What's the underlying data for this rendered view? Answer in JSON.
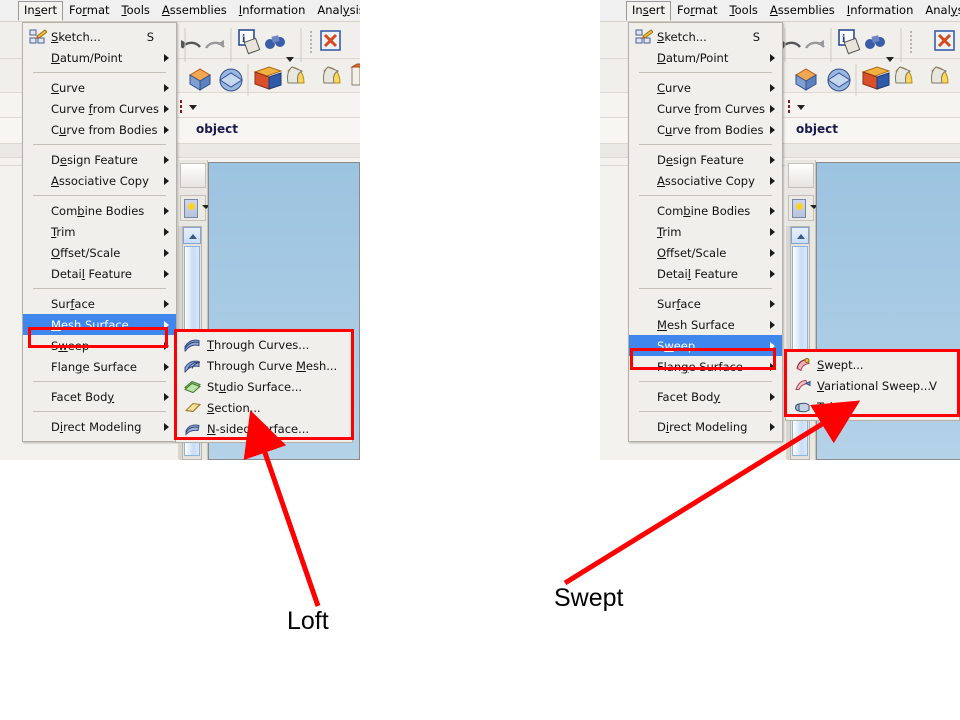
{
  "app": {
    "menubar": [
      {
        "label": "Insert",
        "mnemonic": "s",
        "active": true
      },
      {
        "label": "Format",
        "mnemonic": "r",
        "active": false
      },
      {
        "label": "Tools",
        "mnemonic": "T",
        "active": false
      },
      {
        "label": "Assemblies",
        "mnemonic": "A",
        "active": false
      },
      {
        "label": "Information",
        "mnemonic": "I",
        "active": false
      },
      {
        "label": "Analysis",
        "mnemonic": "y",
        "active": false
      }
    ],
    "cue_text": "object",
    "colors": {
      "menu_background": "#f1efec",
      "menu_highlight": "#3f86ed",
      "annotation_red": "#ff0000",
      "viewport_blue": "#a6cbe4",
      "menubar_background": "#f0f0f0"
    }
  },
  "insert_menu": {
    "title": "Insert",
    "items": [
      {
        "label": "Sketch...",
        "mnemonic": "S",
        "accel": "S",
        "icon": "sketch-icon",
        "submenu": false
      },
      {
        "label": "Datum/Point",
        "mnemonic": "D",
        "accel": "",
        "icon": "",
        "submenu": true
      },
      {
        "separator": true
      },
      {
        "label": "Curve",
        "mnemonic": "C",
        "accel": "",
        "icon": "",
        "submenu": true
      },
      {
        "label": "Curve from Curves",
        "mnemonic": "f",
        "accel": "",
        "icon": "",
        "submenu": true
      },
      {
        "label": "Curve from Bodies",
        "mnemonic": "u",
        "accel": "",
        "icon": "",
        "submenu": true
      },
      {
        "separator": true
      },
      {
        "label": "Design Feature",
        "mnemonic": "e",
        "accel": "",
        "icon": "",
        "submenu": true
      },
      {
        "label": "Associative Copy",
        "mnemonic": "A",
        "accel": "",
        "icon": "",
        "submenu": true
      },
      {
        "separator": true
      },
      {
        "label": "Combine Bodies",
        "mnemonic": "b",
        "accel": "",
        "icon": "",
        "submenu": true
      },
      {
        "label": "Trim",
        "mnemonic": "T",
        "accel": "",
        "icon": "",
        "submenu": true
      },
      {
        "label": "Offset/Scale",
        "mnemonic": "O",
        "accel": "",
        "icon": "",
        "submenu": true
      },
      {
        "label": "Detail Feature",
        "mnemonic": "l",
        "accel": "",
        "icon": "",
        "submenu": true
      },
      {
        "separator": true
      },
      {
        "label": "Surface",
        "mnemonic": "f",
        "accel": "",
        "icon": "",
        "submenu": true
      },
      {
        "label": "Mesh Surface",
        "mnemonic": "M",
        "accel": "",
        "icon": "",
        "submenu": true
      },
      {
        "label": "Sweep",
        "mnemonic": "w",
        "accel": "",
        "icon": "",
        "submenu": true
      },
      {
        "label": "Flange Surface",
        "mnemonic": "g",
        "accel": "",
        "icon": "",
        "submenu": true
      },
      {
        "separator": true
      },
      {
        "label": "Facet Body",
        "mnemonic": "y",
        "accel": "",
        "icon": "",
        "submenu": true
      },
      {
        "separator": true
      },
      {
        "label": "Direct Modeling",
        "mnemonic": "i",
        "accel": "",
        "icon": "",
        "submenu": true
      }
    ]
  },
  "left_panel": {
    "selected_item": "Mesh Surface",
    "annotation_label": "Loft",
    "submenu": {
      "parent": "Mesh Surface",
      "items": [
        {
          "label": "Through Curves...",
          "mnemonic": "T",
          "accel": "",
          "icon": "through-curves-icon"
        },
        {
          "label": "Through Curve Mesh...",
          "mnemonic": "M",
          "accel": "",
          "icon": "through-curve-mesh-icon"
        },
        {
          "label": "Studio Surface...",
          "mnemonic": "u",
          "accel": "",
          "icon": "studio-surface-icon"
        },
        {
          "label": "Section...",
          "mnemonic": "S",
          "accel": "",
          "icon": "section-icon"
        },
        {
          "label": "N-sided Surface...",
          "mnemonic": "N",
          "accel": "",
          "icon": "n-sided-surface-icon"
        }
      ]
    }
  },
  "right_panel": {
    "selected_item": "Sweep",
    "annotation_label": "Swept",
    "submenu": {
      "parent": "Sweep",
      "items": [
        {
          "label": "Swept...",
          "mnemonic": "S",
          "accel": "",
          "icon": "swept-icon"
        },
        {
          "label": "Variational Sweep...",
          "mnemonic": "V",
          "accel": "V",
          "icon": "variational-sweep-icon"
        },
        {
          "label": "Tube...",
          "mnemonic": "T",
          "accel": "",
          "icon": "tube-icon"
        }
      ]
    }
  }
}
